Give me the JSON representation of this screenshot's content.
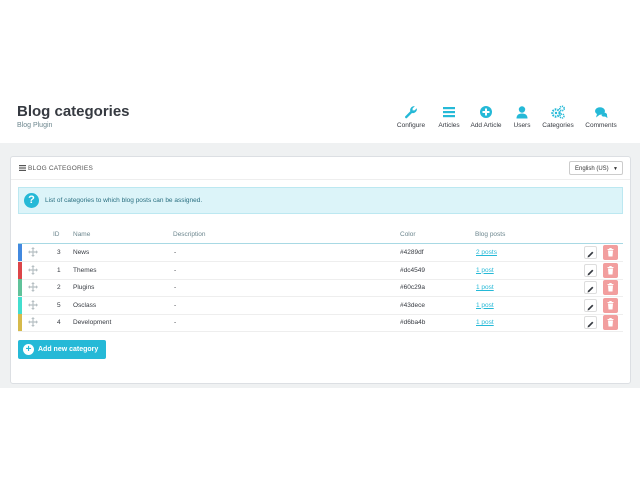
{
  "header": {
    "title": "Blog categories",
    "subtitle": "Blog Plugin"
  },
  "toolbar": [
    {
      "label": "Configure",
      "icon": "wrench-icon"
    },
    {
      "label": "Articles",
      "icon": "list-icon"
    },
    {
      "label": "Add Article",
      "icon": "plus-circle-icon"
    },
    {
      "label": "Users",
      "icon": "user-icon"
    },
    {
      "label": "Categories",
      "icon": "gears-icon"
    },
    {
      "label": "Comments",
      "icon": "comments-icon"
    }
  ],
  "panel": {
    "title": "BLOG CATEGORIES",
    "language": "English (US)",
    "alert": "List of categories to which blog posts can be assigned."
  },
  "table": {
    "columns": [
      "ID",
      "Name",
      "Description",
      "Color",
      "Blog posts"
    ],
    "rows": [
      {
        "id": "3",
        "name": "News",
        "description": "-",
        "color": "#4289df",
        "posts": "2 posts"
      },
      {
        "id": "1",
        "name": "Themes",
        "description": "-",
        "color": "#dc4549",
        "posts": "1 post"
      },
      {
        "id": "2",
        "name": "Plugins",
        "description": "-",
        "color": "#60c29a",
        "posts": "1 post"
      },
      {
        "id": "5",
        "name": "Osclass",
        "description": "-",
        "color": "#43dece",
        "posts": "1 post"
      },
      {
        "id": "4",
        "name": "Development",
        "description": "-",
        "color": "#d6ba4b",
        "posts": "1 post"
      }
    ]
  },
  "add_button": "Add new category",
  "colors": {
    "accent": "#25b9d7",
    "delete": "#f29e9e"
  }
}
